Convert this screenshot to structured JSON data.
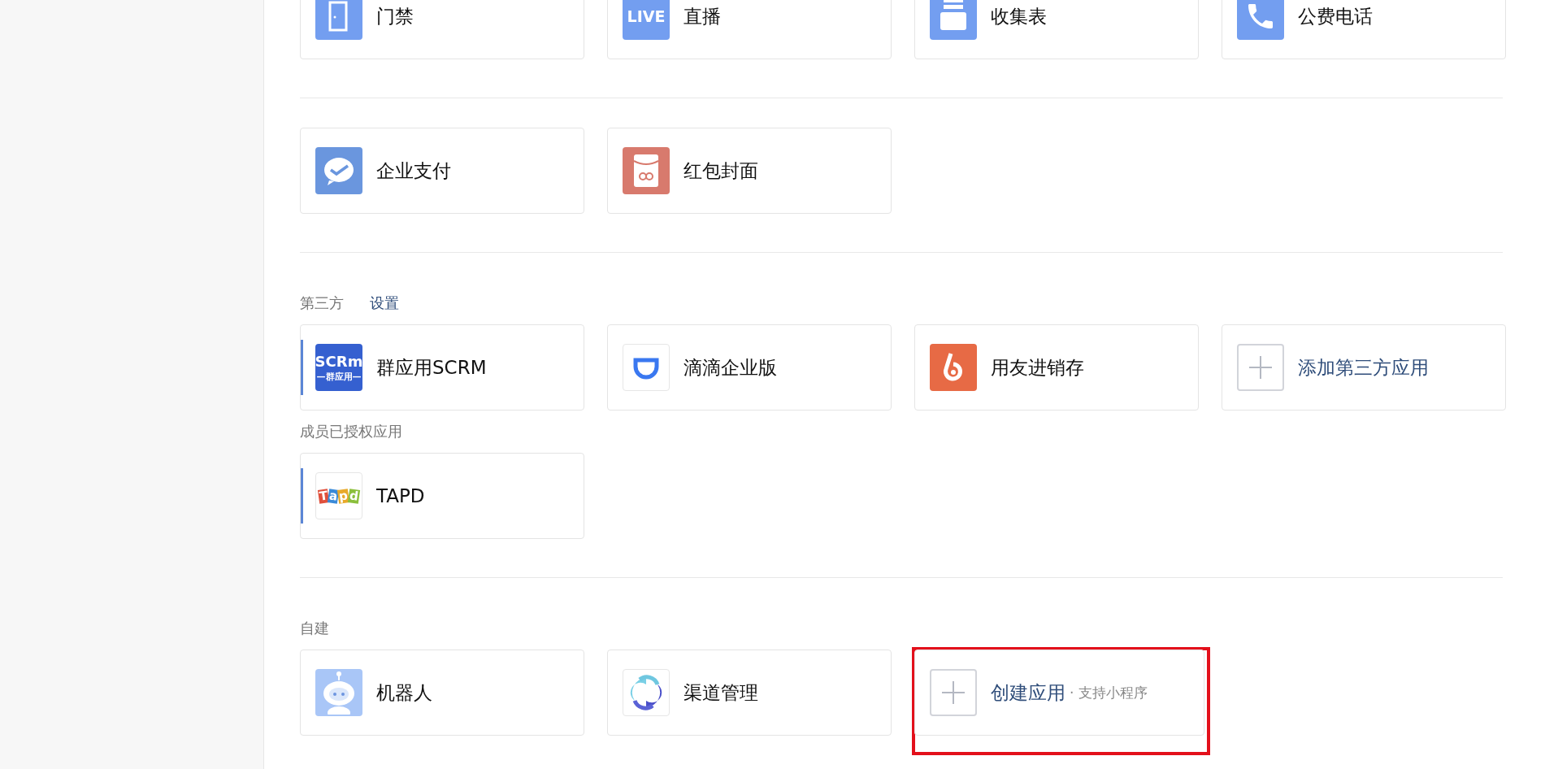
{
  "groups": [
    {
      "sections": [
        {
          "apps": [
            {
              "kind": "app",
              "name": "门禁",
              "marked": false
            },
            {
              "kind": "app",
              "logo_text": [
                "LIVE"
              ],
              "name": "直播",
              "marked": false
            },
            {
              "kind": "app",
              "name": "收集表",
              "marked": false
            },
            {
              "kind": "app",
              "name": "公费电话",
              "marked": false
            }
          ]
        }
      ]
    },
    {
      "sections": [
        {
          "apps": [
            {
              "kind": "app",
              "name": "企业支付",
              "marked": false
            },
            {
              "kind": "app",
              "name": "红包封面",
              "marked": false
            }
          ]
        }
      ]
    },
    {
      "sections": [
        {
          "label": "第三方",
          "link": "设置",
          "apps": [
            {
              "kind": "app",
              "logo_text": [
                "SCRm",
                "—群应用—"
              ],
              "name": "群应用SCRM",
              "marked": true
            },
            {
              "kind": "app",
              "name": "滴滴企业版",
              "marked": false
            },
            {
              "kind": "app",
              "name": "用友进销存",
              "marked": false
            },
            {
              "kind": "add",
              "name": "添加第三方应用",
              "marked": false
            }
          ]
        },
        {
          "label": "成员已授权应用",
          "apps": [
            {
              "kind": "app",
              "logo_text": [
                "T",
                "a",
                "p",
                "d"
              ],
              "name": "TAPD",
              "marked": true
            }
          ]
        }
      ]
    },
    {
      "sections": [
        {
          "label": "自建",
          "apps": [
            {
              "kind": "app",
              "name": "机器人",
              "marked": false
            },
            {
              "kind": "app",
              "name": "渠道管理",
              "marked": false
            },
            {
              "kind": "add",
              "name": "创建应用",
              "note": "· 支持小程序",
              "marked": false,
              "highlighted": true
            }
          ]
        }
      ]
    }
  ]
}
